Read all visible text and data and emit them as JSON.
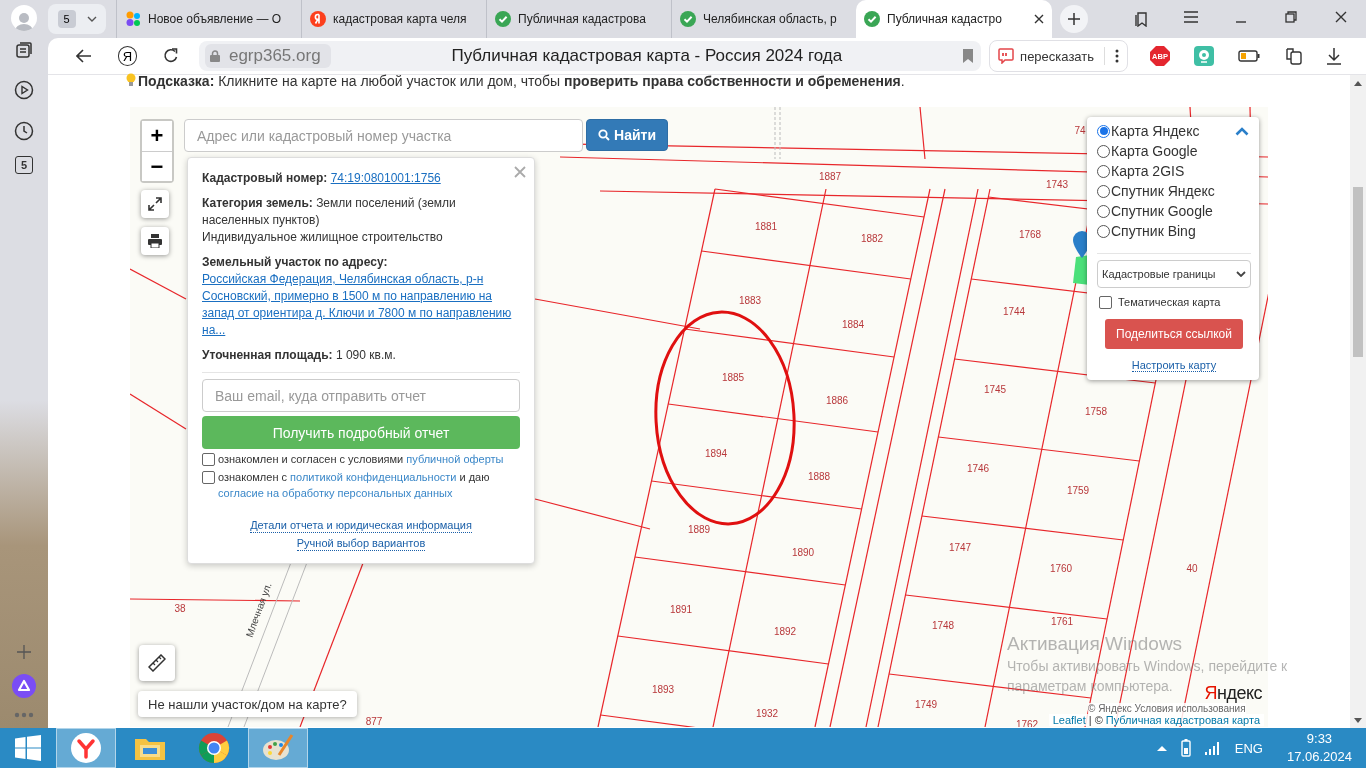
{
  "browser": {
    "tab_counter": "5",
    "tabs": [
      {
        "title": "Новое объявление — О",
        "kind": "dots",
        "selected": false
      },
      {
        "title": "кадастровая карта челя",
        "kind": "yandex",
        "selected": false
      },
      {
        "title": "Публичная кадастрова",
        "kind": "check",
        "selected": false
      },
      {
        "title": "Челябинская область, р",
        "kind": "check",
        "selected": false
      },
      {
        "title": "Публичная кадастро",
        "kind": "check",
        "selected": true
      }
    ],
    "toolbar": {
      "yandex_button": "Я",
      "url": "egrp365.org",
      "page_title": "Публичная кадастровая карта - Россия 2024 года",
      "retell_button": "пересказать",
      "adblock_badge": "ABP"
    },
    "sidebar": {
      "counter": "5"
    }
  },
  "page": {
    "hint": "**Подсказка:** Кликните на карте на любой участок или дом, чтобы **проверить права собственности и обременения**."
  },
  "map": {
    "zoom_in": "+",
    "zoom_out": "−",
    "search": {
      "placeholder": "Адрес или кадастровый номер участка",
      "button": "Найти"
    },
    "popup": {
      "fields": [
        {
          "kind": "link",
          "label": "Кадастровый номер:",
          "value": "74:19:0801001:1756"
        },
        {
          "kind": "text",
          "label": "Категория земель:",
          "value": "Земли поселений (земли населенных пунктов)",
          "note": "Индивидуальное жилищное строительство"
        },
        {
          "kind": "link",
          "label": "Земельный участок по адресу:",
          "value": "Российская Федерация, Челябинская область, р-н Сосновский, примерно в 1500 м по направлению на запад от ориентира д. Ключи и 7800 м по направлению на..."
        },
        {
          "kind": "text",
          "label": "Уточненная площадь:",
          "value": "1 090 кв.м."
        }
      ],
      "email_placeholder": "Ваш email, куда отправить отчет",
      "report_button": "Получить подробный отчет",
      "consents": [
        {
          "checked": false,
          "parts": [
            {
              "kind": "text",
              "text": "ознакомлен и согласен с условиями "
            },
            {
              "kind": "link",
              "text": "публичной оферты"
            }
          ]
        },
        {
          "checked": false,
          "parts": [
            {
              "kind": "text",
              "text": "ознакомлен с "
            },
            {
              "kind": "link",
              "text": "политикой конфиденциальности"
            },
            {
              "kind": "text",
              "text": " и даю "
            },
            {
              "kind": "link",
              "text": "согласие на обработку персональных данных"
            }
          ]
        }
      ],
      "links": [
        "Детали отчета и юридическая информация",
        "Ручной выбор вариантов"
      ]
    },
    "layers": {
      "options": [
        {
          "label": "Карта Яндекс",
          "selected": true
        },
        {
          "label": "Карта Google",
          "selected": false
        },
        {
          "label": "Карта 2GIS",
          "selected": false
        },
        {
          "label": "Спутник Яндекс",
          "selected": false
        },
        {
          "label": "Спутник Google",
          "selected": false
        },
        {
          "label": "Спутник Bing",
          "selected": false
        }
      ],
      "overlay_select": "Кадастровые границы",
      "thematic": {
        "label": "Тематическая карта",
        "checked": false
      },
      "share_button": "Поделиться ссылкой",
      "configure_link": "Настроить карту"
    },
    "parcels": [
      "1881",
      "1882",
      "1883",
      "1884",
      "1885",
      "1886",
      "1894",
      "1888",
      "1889",
      "1890",
      "1891",
      "1892",
      "1893",
      "1932",
      "1887",
      "74",
      "1743",
      "1768",
      "1744",
      "1745",
      "1758",
      "1746",
      "1759",
      "1747",
      "1760",
      "40",
      "1748",
      "1761",
      "1749",
      "1762",
      "38",
      "877"
    ],
    "street": "Млечная ул.",
    "not_found_button": "Не нашли участок/дом на карте?",
    "logo": {
      "first": "Я",
      "rest": "ндекс"
    },
    "provider_note": "© Яндекс  Условия использования",
    "attribution": {
      "leaflet": "Leaflet",
      "separator": "| ©",
      "source": "Публичная кадастровая карта"
    }
  },
  "activation": {
    "title": "Активация Windows",
    "lines": [
      "Чтобы активировать Windows, перейдите к",
      "параметрам компьютера."
    ]
  },
  "taskbar": {
    "apps": [
      {
        "kind": "yandex",
        "active": true
      },
      {
        "kind": "explorer",
        "active": false
      },
      {
        "kind": "chrome",
        "active": false
      },
      {
        "kind": "paint",
        "active": true
      }
    ],
    "language": "ENG",
    "time": "9:33",
    "date": "17.06.2024"
  }
}
